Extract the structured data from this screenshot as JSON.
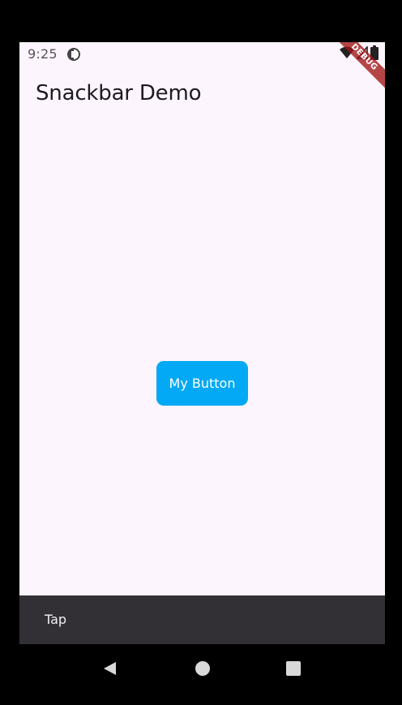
{
  "status_bar": {
    "time": "9:25"
  },
  "debug_banner": {
    "label": "DEBUG"
  },
  "app_bar": {
    "title": "Snackbar Demo"
  },
  "main": {
    "button_label": "My Button"
  },
  "snackbar": {
    "message": "Tap"
  },
  "colors": {
    "background": "#fcf5fd",
    "button": "#03a9f4",
    "snackbar": "#323035",
    "debug_banner": "#a01414"
  },
  "icons": {
    "status_notification": "circle-half-icon",
    "wifi": "wifi-icon",
    "signal": "signal-icon",
    "battery": "battery-icon",
    "nav_back": "back-triangle-icon",
    "nav_home": "home-circle-icon",
    "nav_recents": "recents-square-icon"
  }
}
